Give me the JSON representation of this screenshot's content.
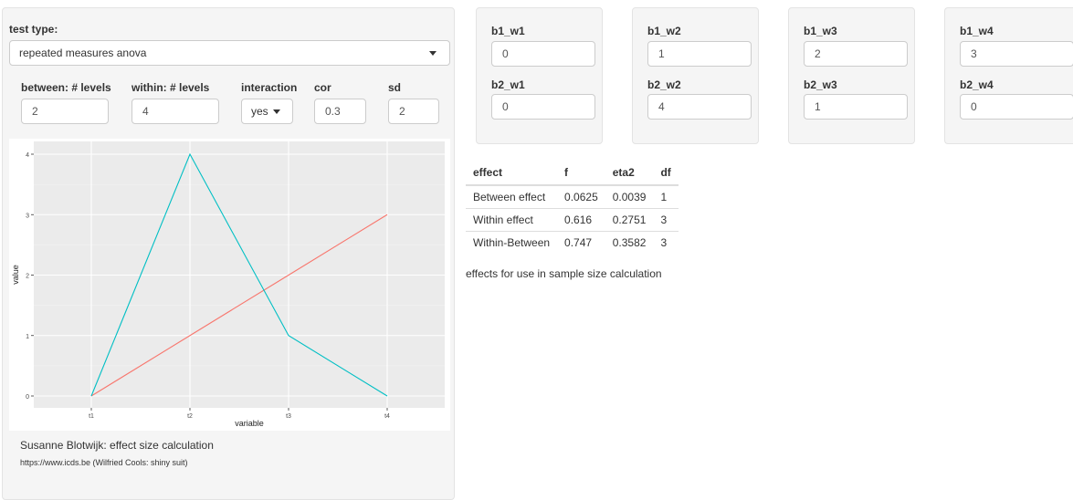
{
  "sidebar": {
    "test_type_label": "test type:",
    "test_type_value": "repeated measures anova",
    "between_label": "between: # levels",
    "between_value": "2",
    "within_label": "within: # levels",
    "within_value": "4",
    "interaction_label": "interaction",
    "interaction_value": "yes",
    "cor_label": "cor",
    "cor_value": "0.3",
    "sd_label": "sd",
    "sd_value": "2",
    "footer_title": "Susanne Blotwijk: effect size calculation",
    "footer_credit": "https://www.icds.be (Wilfried Cools: shiny suit)"
  },
  "means": [
    {
      "b1_label": "b1_w1",
      "b1_value": "0",
      "b2_label": "b2_w1",
      "b2_value": "0"
    },
    {
      "b1_label": "b1_w2",
      "b1_value": "1",
      "b2_label": "b2_w2",
      "b2_value": "4"
    },
    {
      "b1_label": "b1_w3",
      "b1_value": "2",
      "b2_label": "b2_w3",
      "b2_value": "1"
    },
    {
      "b1_label": "b1_w4",
      "b1_value": "3",
      "b2_label": "b2_w4",
      "b2_value": "0"
    }
  ],
  "effects_table": {
    "headers": [
      "effect",
      "f",
      "eta2",
      "df"
    ],
    "rows": [
      [
        "Between effect",
        "0.0625",
        "0.0039",
        "1"
      ],
      [
        "Within effect",
        "0.616",
        "0.2751",
        "3"
      ],
      [
        "Within-Between",
        "0.747",
        "0.3582",
        "3"
      ]
    ]
  },
  "effects_note": "effects for use in sample size calculation",
  "chart_data": {
    "type": "line",
    "categories": [
      "t1",
      "t2",
      "t3",
      "t4"
    ],
    "xlabel": "variable",
    "ylabel": "value",
    "ylim": [
      0,
      4
    ],
    "y_ticks": [
      0,
      1,
      2,
      3,
      4
    ],
    "grid": true,
    "series": [
      {
        "values": [
          0,
          1,
          2,
          3
        ],
        "color": "#F8766D"
      },
      {
        "values": [
          0,
          4,
          1,
          0
        ],
        "color": "#00BFC4"
      }
    ]
  }
}
